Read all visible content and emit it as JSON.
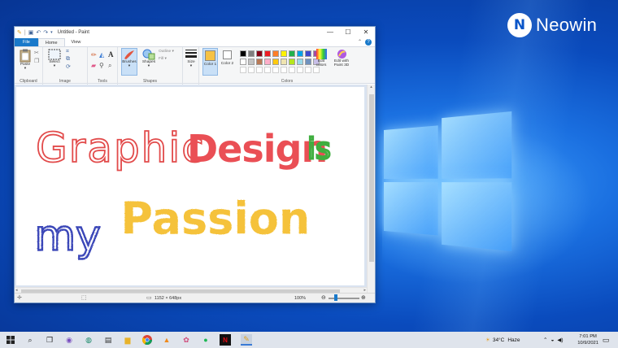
{
  "brand": {
    "name": "Neowin",
    "logo_letter": "N"
  },
  "window": {
    "title": "Untitled - Paint",
    "controls": {
      "minimize": "—",
      "maximize": "☐",
      "close": "✕"
    }
  },
  "tabs": [
    {
      "label": "File"
    },
    {
      "label": "Home"
    },
    {
      "label": "View"
    }
  ],
  "ribbon": {
    "groups": {
      "clipboard": "Clipboard",
      "image": "Image",
      "tools": "Tools",
      "shapes": "Shapes",
      "colors": "Colors"
    },
    "paste": "Paste",
    "select": "Select",
    "brushes": "Brushes",
    "shapes_btn": "Shapes",
    "outline": "Outline",
    "fill": "Fill",
    "size": "Size",
    "color1": "Color 1",
    "color2": "Color 2",
    "edit_colors": "Edit colors",
    "edit_paint3d": "Edit with Paint 3D",
    "color1_value": "#f6c244",
    "color2_value": "#ffffff",
    "palette_row1": [
      "#000000",
      "#7f7f7f",
      "#880015",
      "#ed1c24",
      "#ff7f27",
      "#fff200",
      "#22b14c",
      "#00a2e8",
      "#3f48cc",
      "#a349a4"
    ],
    "palette_row2": [
      "#ffffff",
      "#c3c3c3",
      "#b97a57",
      "#ffaec9",
      "#ffc90e",
      "#efe4b0",
      "#b5e61d",
      "#99d9ea",
      "#7092be",
      "#c8bfe7"
    ]
  },
  "canvas_text": {
    "graphic": "Graphic",
    "design": "Design",
    "is": "is",
    "my": "my",
    "passion": "Passion"
  },
  "status": {
    "dimensions": "1152 × 648px",
    "zoom": "100%"
  },
  "tray": {
    "temperature": "34°C",
    "weather": "Haze",
    "time": "7:01 PM",
    "date": "10/9/2021"
  }
}
